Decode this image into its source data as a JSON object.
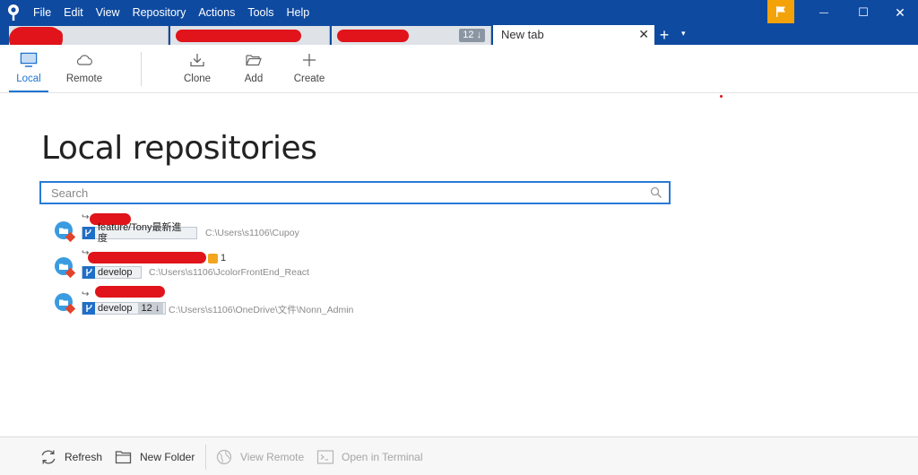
{
  "app": {
    "menu": [
      "File",
      "Edit",
      "View",
      "Repository",
      "Actions",
      "Tools",
      "Help"
    ]
  },
  "tabs": [
    {
      "badge": ""
    },
    {
      "badge": ""
    },
    {
      "badge": "12 ↓"
    },
    {
      "label": "New tab",
      "close": "✕"
    }
  ],
  "new_tab": "+",
  "tab_dropdown": "▾",
  "window": {
    "minimize": "—",
    "maximize": "☐",
    "close": "✕"
  },
  "toolbar": {
    "local": "Local",
    "remote": "Remote",
    "clone": "Clone",
    "add": "Add",
    "create": "Create"
  },
  "main": {
    "title": "Local repositories",
    "search_placeholder": "Search"
  },
  "repos": [
    {
      "branch": "feature/Tony最新進度",
      "behind": "",
      "path": "C:\\Users\\s1106\\Cupoy",
      "changes": ""
    },
    {
      "branch": "develop",
      "behind": "",
      "path": "C:\\Users\\s1106\\JcolorFrontEnd_React",
      "changes": "1"
    },
    {
      "branch": "develop",
      "behind": "12 ↓",
      "path": "C:\\Users\\s1106\\OneDrive\\文件\\Nonn_Admin",
      "changes": ""
    }
  ],
  "bottombar": {
    "refresh": "Refresh",
    "new_folder": "New Folder",
    "view_remote": "View Remote",
    "open_terminal": "Open in Terminal"
  },
  "colors": {
    "titlebar": "#0e4aa0",
    "accent": "#1f73d1",
    "flag": "#f4a20a",
    "redaction": "#e0141a"
  }
}
